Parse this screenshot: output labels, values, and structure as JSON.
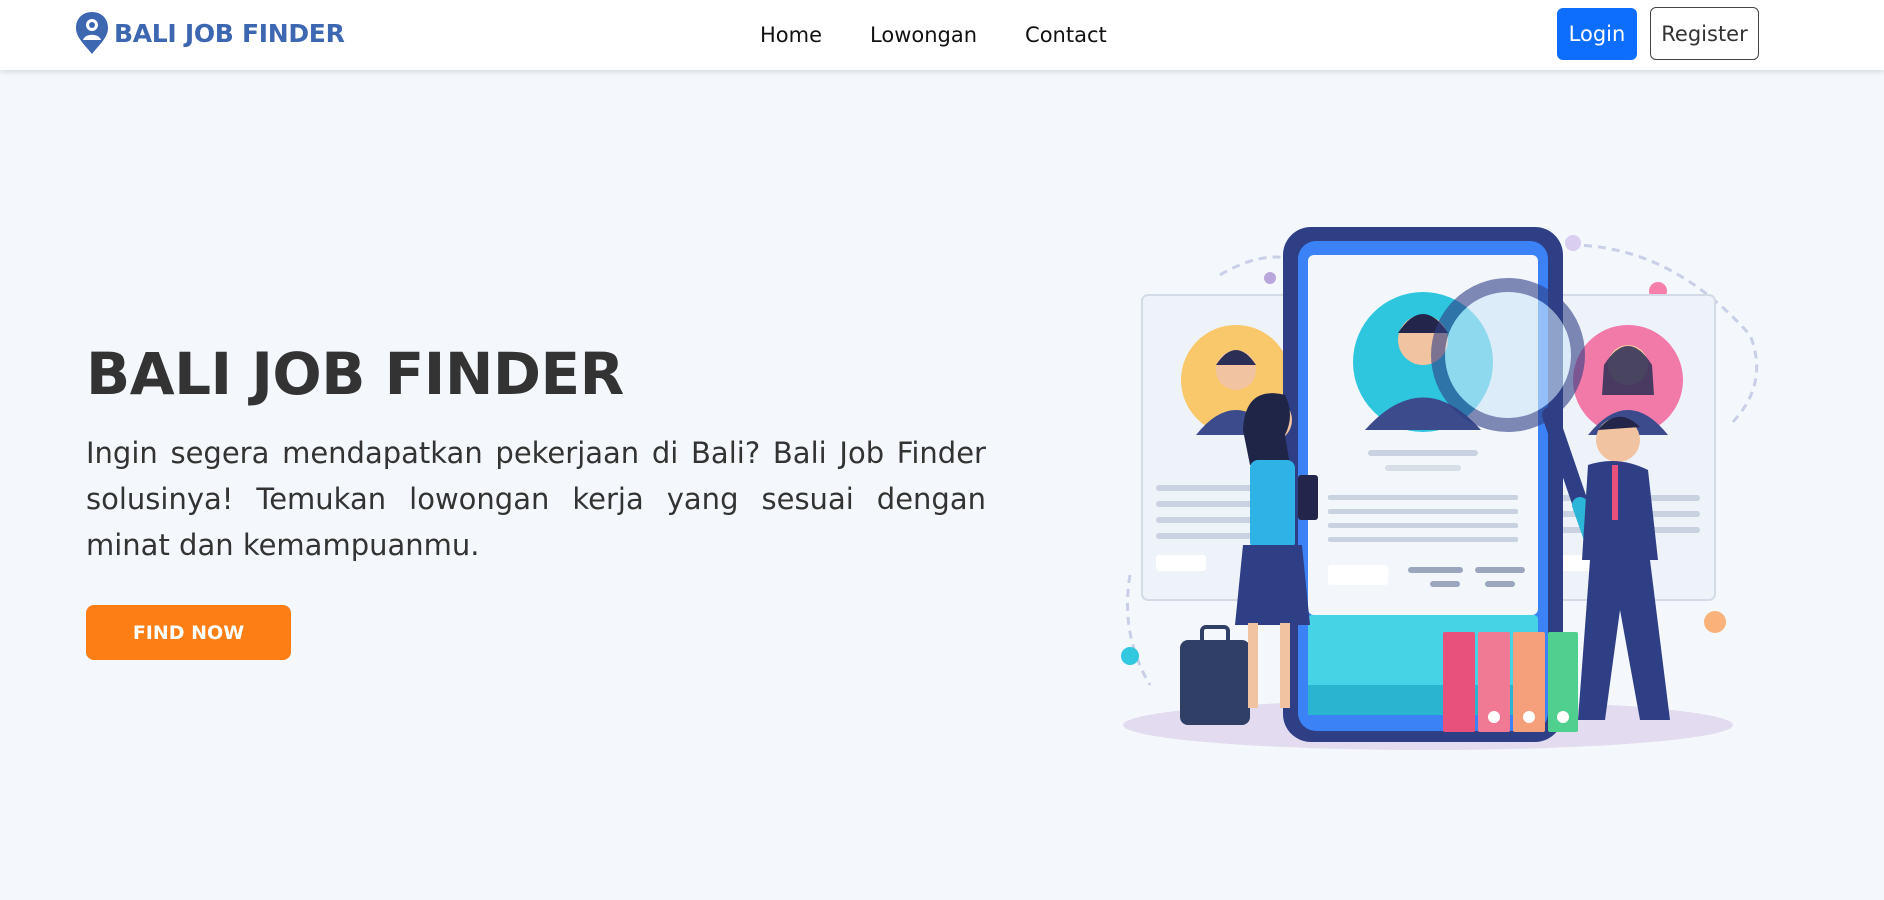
{
  "navbar": {
    "brand": "BALI JOB FINDER",
    "links": [
      "Home",
      "Lowongan",
      "Contact"
    ],
    "login_label": "Login",
    "register_label": "Register"
  },
  "hero": {
    "title": "BALI JOB FINDER",
    "description": "Ingin segera mendapatkan pekerjaan di Bali? Bali Job Finder solusinya! Temukan lowongan kerja yang sesuai dengan minat dan kemampuanmu.",
    "cta_label": "FIND NOW"
  },
  "colors": {
    "brand": "#3e67b2",
    "login_button": "#0d6efd",
    "cta_button": "#fd7e14",
    "hero_background": "#f4f8fc"
  },
  "icons": {
    "brand": "location-pin-person-icon"
  }
}
